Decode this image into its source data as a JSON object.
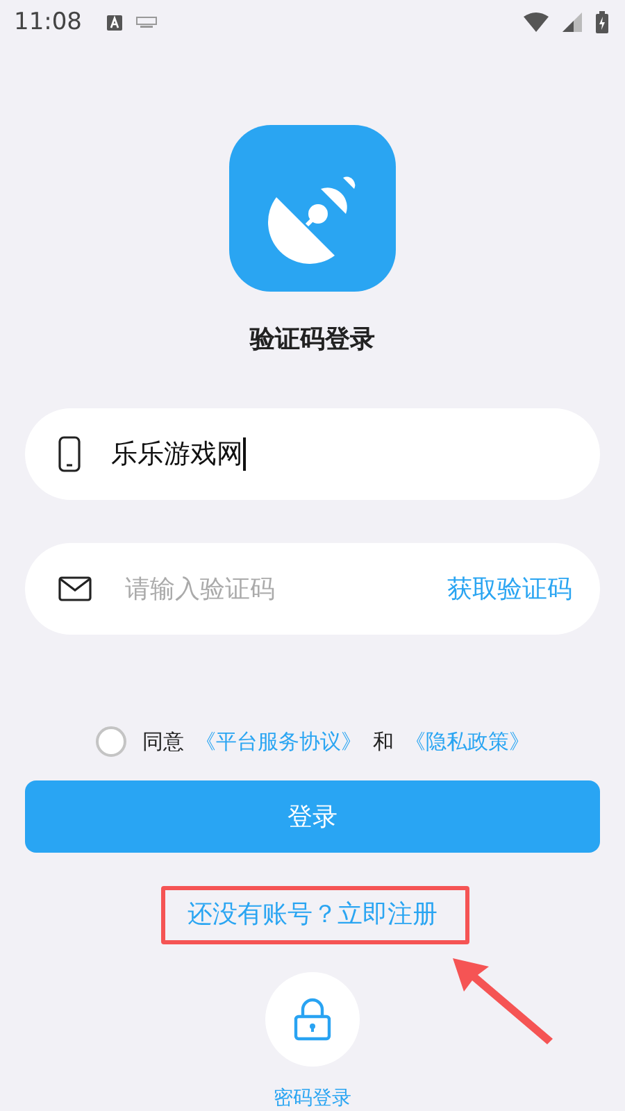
{
  "status_bar": {
    "time": "11:08"
  },
  "title": "验证码登录",
  "phone_field": {
    "value": "乐乐游戏网",
    "focused": true
  },
  "code_field": {
    "placeholder": "请输入验证码",
    "action": "获取验证码"
  },
  "agreement": {
    "checked": false,
    "parts": [
      {
        "kind": "text",
        "text": "同意"
      },
      {
        "kind": "link",
        "text": "《平台服务协议》"
      },
      {
        "kind": "text",
        "text": "和"
      },
      {
        "kind": "link",
        "text": "《隐私政策》"
      }
    ]
  },
  "login_button": "登录",
  "register_link": "还没有账号？立即注册",
  "password_login": "密码登录"
}
